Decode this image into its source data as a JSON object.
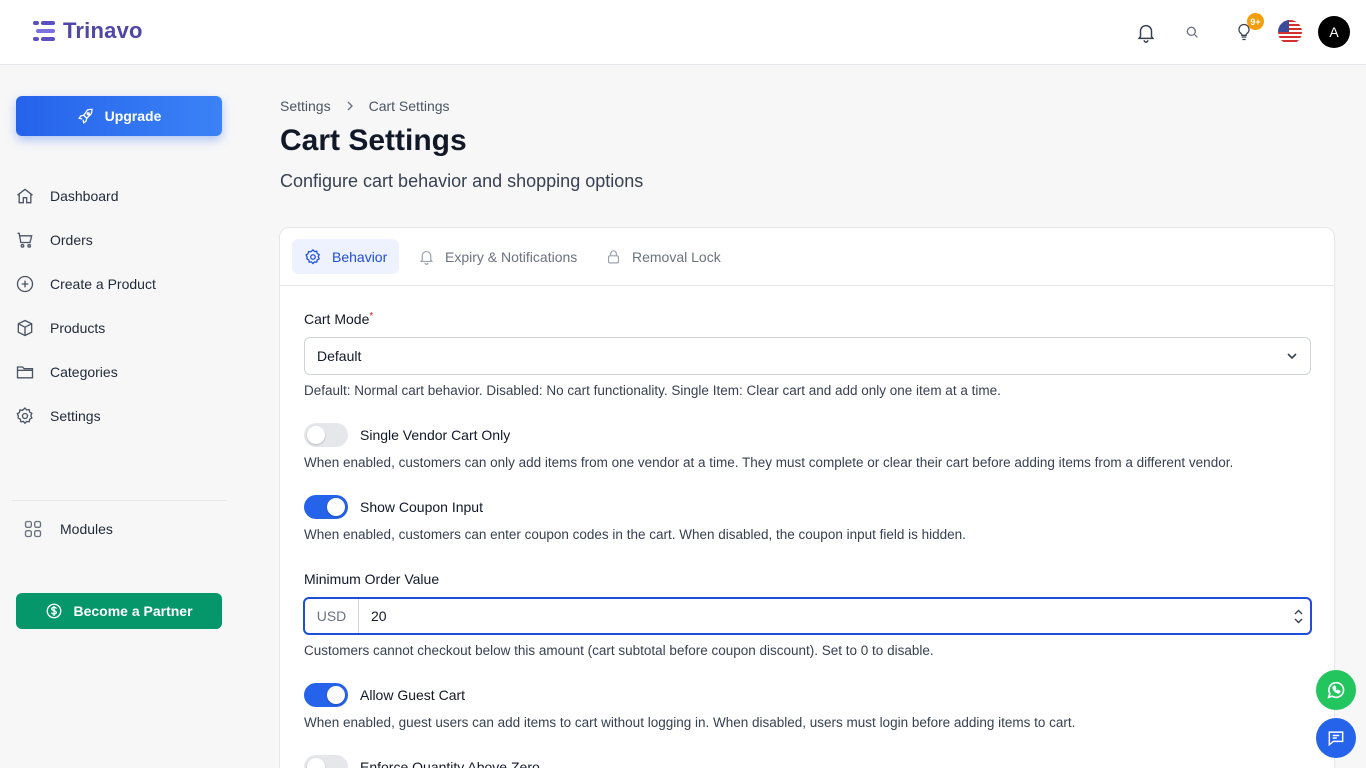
{
  "brand": {
    "name": "Trinavo"
  },
  "header": {
    "notification_badge": "9+",
    "avatar_initial": "A"
  },
  "sidebar": {
    "upgrade_label": "Upgrade",
    "items": [
      {
        "label": "Dashboard",
        "icon": "home-icon"
      },
      {
        "label": "Orders",
        "icon": "cart-icon"
      },
      {
        "label": "Create a Product",
        "icon": "plus-circle-icon"
      },
      {
        "label": "Products",
        "icon": "box-icon"
      },
      {
        "label": "Categories",
        "icon": "folder-icon"
      },
      {
        "label": "Settings",
        "icon": "gear-icon"
      }
    ],
    "modules_label": "Modules",
    "partner_label": "Become a Partner"
  },
  "breadcrumb": {
    "parent": "Settings",
    "current": "Cart Settings"
  },
  "page": {
    "title": "Cart Settings",
    "subtitle": "Configure cart behavior and shopping options"
  },
  "tabs": [
    {
      "label": "Behavior",
      "active": true
    },
    {
      "label": "Expiry & Notifications",
      "active": false
    },
    {
      "label": "Removal Lock",
      "active": false
    }
  ],
  "form": {
    "cart_mode": {
      "label": "Cart Mode",
      "required_mark": "*",
      "value": "Default",
      "help": "Default: Normal cart behavior. Disabled: No cart functionality. Single Item: Clear cart and add only one item at a time."
    },
    "single_vendor": {
      "label": "Single Vendor Cart Only",
      "enabled": false,
      "help": "When enabled, customers can only add items from one vendor at a time. They must complete or clear their cart before adding items from a different vendor."
    },
    "coupon": {
      "label": "Show Coupon Input",
      "enabled": true,
      "help": "When enabled, customers can enter coupon codes in the cart. When disabled, the coupon input field is hidden."
    },
    "min_order": {
      "label": "Minimum Order Value",
      "currency": "USD",
      "value": "20",
      "help": "Customers cannot checkout below this amount (cart subtotal before coupon discount). Set to 0 to disable."
    },
    "guest_cart": {
      "label": "Allow Guest Cart",
      "enabled": true,
      "help": "When enabled, guest users can add items to cart without logging in. When disabled, users must login before adding items to cart."
    },
    "enforce_qty": {
      "label": "Enforce Quantity Above Zero",
      "enabled": false
    }
  },
  "colors": {
    "primary": "#2563eb",
    "partner": "#059669",
    "whatsapp": "#22c55e",
    "badge": "#f59e0b"
  }
}
